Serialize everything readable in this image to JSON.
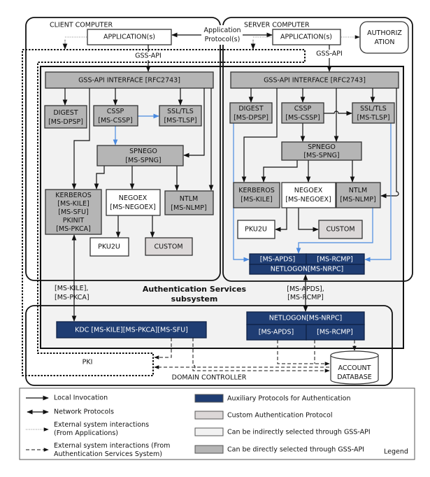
{
  "client": {
    "title": "CLIENT COMPUTER",
    "application": "APPLICATION(s)",
    "gss_api": "GSS-API",
    "interface": "GSS-API INTERFACE [RFC2743]",
    "digest": [
      "DIGEST",
      "[MS-DPSP]"
    ],
    "cssp": [
      "CSSP",
      "[MS-CSSP]"
    ],
    "ssl": [
      "SSL/TLS",
      "[MS-TLSP]"
    ],
    "spnego": [
      "SPNEGO",
      "[MS-SPNG]"
    ],
    "kerberos": [
      "KERBEROS",
      "[MS-KILE]",
      "[MS-SFU]",
      "PKINIT",
      "[MS-PKCA]"
    ],
    "negoex": [
      "NEGOEX",
      "[MS-NEGOEX]"
    ],
    "ntlm": [
      "NTLM",
      "[MS-NLMP]"
    ],
    "pku2u": "PKU2U",
    "custom": "CUSTOM",
    "kdc_link": [
      "[MS-KILE],",
      "[MS-PKCA]"
    ]
  },
  "app_protocol": [
    "Application",
    "Protocol(s)"
  ],
  "server": {
    "title": "SERVER COMPUTER",
    "application": "APPLICATION(s)",
    "authorization": [
      "AUTHORIZ",
      "ATION"
    ],
    "gss_api": "GSS-API",
    "interface": "GSS-API INTERFACE [RFC2743]",
    "digest": [
      "DIGEST",
      "[MS-DPSP]"
    ],
    "cssp": [
      "CSSP",
      "[MS-CSSP]"
    ],
    "ssl": [
      "SSL/TLS",
      "[MS-TLSP]"
    ],
    "spnego": [
      "SPNEGO",
      "[MS-SPNG]"
    ],
    "kerberos": [
      "KERBEROS",
      "[MS-KILE]"
    ],
    "negoex": [
      "NEGOEX",
      "[MS-NEGOEX]"
    ],
    "ntlm": [
      "NTLM",
      "[MS-NLMP]"
    ],
    "pku2u": "PKU2U",
    "custom": "CUSTOM",
    "aux": {
      "apds": "[MS-APDS]",
      "rcmp": "[MS-RCMP]",
      "netlogon": "NETLOGON[MS-NRPC]"
    },
    "dc_link": [
      "[MS-APDS],",
      "[MS-RCMP]"
    ]
  },
  "subsystem": [
    "Authentication Services",
    "subsystem"
  ],
  "domain_controller": {
    "title": "DOMAIN CONTROLLER",
    "kdc": "KDC [MS-KILE][MS-PKCA][MS-SFU]",
    "netlogon": "NETLOGON[MS-NRPC]",
    "apds": "[MS-APDS]",
    "rcmp": "[MS-RCMP]",
    "pki": "PKI",
    "account_db": [
      "ACCOUNT",
      "DATABASE"
    ]
  },
  "legend": {
    "title": "Legend",
    "lines": [
      [
        "Local Invocation"
      ],
      [
        "Network Protocols"
      ],
      [
        "External system interactions",
        "(From Applications)"
      ],
      [
        "External system interactions (From",
        "Authentication Services System)"
      ]
    ],
    "swatches": [
      {
        "label": "Auxiliary Protocols for Authentication",
        "color": "#1f3d73"
      },
      {
        "label": "Custom Authentication Protocol",
        "color": "#dcd8d8"
      },
      {
        "label": "Can be indirectly selected through GSS-API",
        "color": "#f2f2f2"
      },
      {
        "label": "Can be directly selected through GSS-API",
        "color": "#b5b5b5"
      }
    ]
  },
  "colors": {
    "auxiliary": "#1f3d73",
    "custom": "#dcd8d8",
    "indirect": "#f2f2f2",
    "direct": "#b5b5b5",
    "blue_arrow": "#4a8ae0"
  }
}
